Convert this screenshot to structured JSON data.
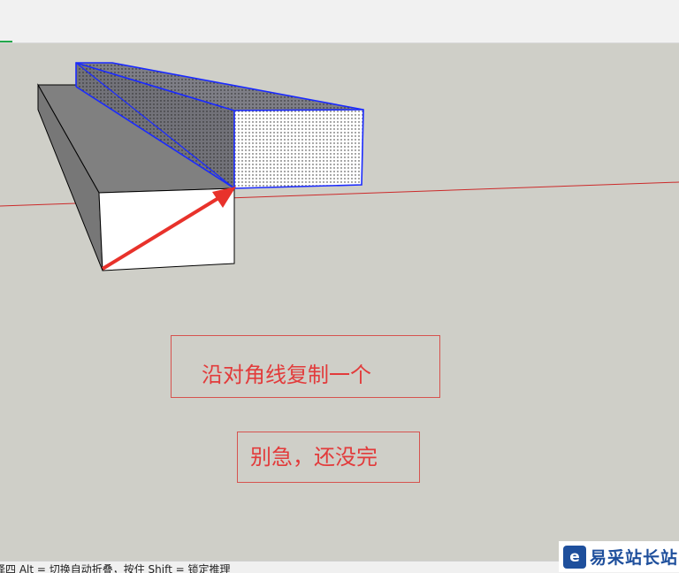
{
  "viewport": {
    "note_1": "沿对角线复制一个",
    "note_2": "别急，还没完"
  },
  "status_bar": {
    "hint": "择四 Alt = 切换自动折叠，按住 Shift = 锁定推理"
  },
  "watermark": {
    "logo_glyph": "e",
    "text": "易采站长站"
  },
  "colors": {
    "selection": "#1a2aff",
    "annotation": "#e23b3b",
    "red_axis": "#cc2a2a",
    "background": "#cfcfc8"
  }
}
